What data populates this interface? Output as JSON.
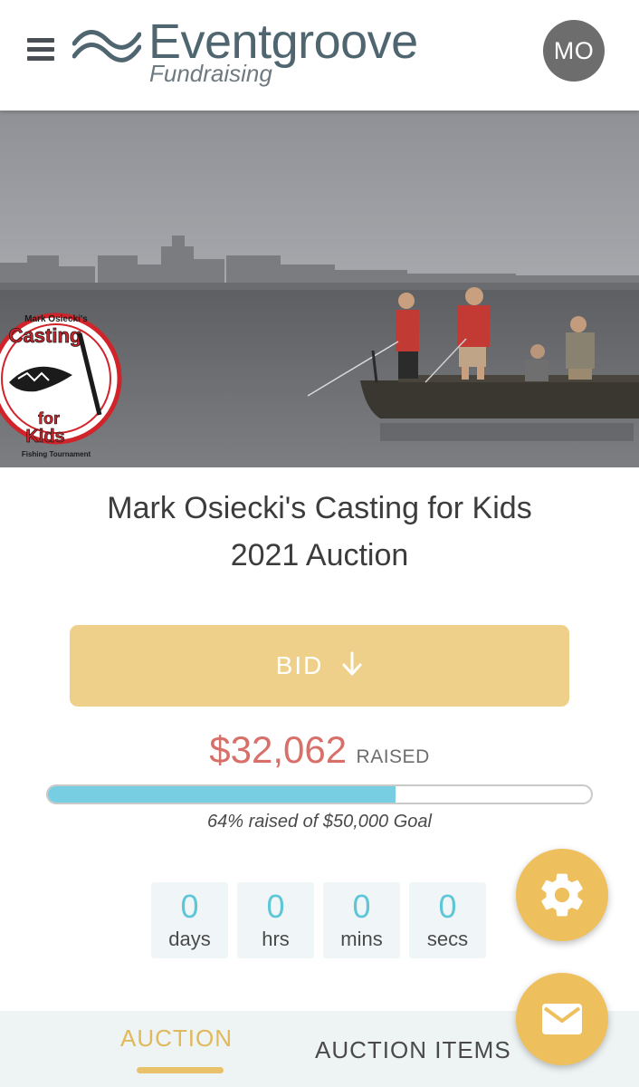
{
  "header": {
    "brand_name": "Eventgroove",
    "brand_sub": "Fundraising",
    "avatar_initials": "MO"
  },
  "hero": {
    "logo_top": "Mark Osiecki's",
    "logo_line1": "Casting",
    "logo_line2": "for",
    "logo_line3": "Kids",
    "logo_bottom": "Fishing Tournament"
  },
  "event": {
    "title_line1": "Mark Osiecki's Casting for Kids",
    "title_line2": "2021 Auction"
  },
  "bid": {
    "label": "BID",
    "icon": "arrow-down-icon"
  },
  "fundraising": {
    "amount": "$32,062",
    "raised_label": "RAISED",
    "progress_fraction": 0.64,
    "goal_text": "64% raised of $50,000 Goal"
  },
  "countdown": [
    {
      "value": "0",
      "unit": "days"
    },
    {
      "value": "0",
      "unit": "hrs"
    },
    {
      "value": "0",
      "unit": "mins"
    },
    {
      "value": "0",
      "unit": "secs"
    }
  ],
  "tabs": {
    "auction": "AUCTION",
    "auction_items": "AUCTION ITEMS"
  },
  "fabs": {
    "settings_icon": "gear-icon",
    "mail_icon": "mail-icon"
  },
  "colors": {
    "accent_gold": "#eec05d",
    "bid_button": "#efd08b",
    "raised_red": "#d86f68",
    "progress_blue": "#77cde2",
    "countdown_teal": "#5fc6d8"
  }
}
